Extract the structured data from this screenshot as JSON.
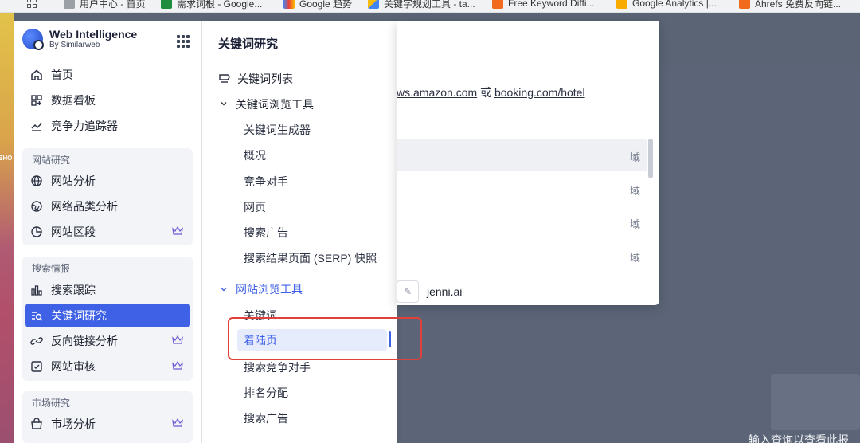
{
  "bookmarks": [
    {
      "label": "用户中心 - 首页",
      "color": "#6b7280"
    },
    {
      "label": "需求词根 - Google...",
      "color": "#1e8e3e"
    },
    {
      "label": "Google 趋势",
      "color": "#4285f4"
    },
    {
      "label": "关键字规划工具 - ta...",
      "color": "#fbbc04"
    },
    {
      "label": "Free Keyword Diffi...",
      "color": "#f26b1d"
    },
    {
      "label": "Google Analytics |...",
      "color": "#f9ab00"
    },
    {
      "label": "Ahrefs 免费反向链...",
      "color": "#f26b1d"
    }
  ],
  "sidebar": {
    "brand_title": "Web Intelligence",
    "brand_sub": "By Similarweb",
    "top_items": [
      {
        "label": "首页",
        "icon": "home-icon"
      },
      {
        "label": "数据看板",
        "icon": "dashboard-icon"
      },
      {
        "label": "竞争力追踪器",
        "icon": "trend-icon"
      }
    ],
    "groups": [
      {
        "label": "网站研究",
        "items": [
          {
            "label": "网站分析",
            "icon": "globe-icon",
            "crown": false
          },
          {
            "label": "网络品类分析",
            "icon": "globe-category-icon",
            "crown": false
          },
          {
            "label": "网站区段",
            "icon": "pie-icon",
            "crown": true
          }
        ]
      },
      {
        "label": "搜索情报",
        "items": [
          {
            "label": "搜索跟踪",
            "icon": "bar-chart-icon",
            "crown": false
          },
          {
            "label": "关键词研究",
            "icon": "keyword-search-icon",
            "crown": false,
            "active": true
          },
          {
            "label": "反向链接分析",
            "icon": "link-icon",
            "crown": true
          },
          {
            "label": "网站审核",
            "icon": "audit-icon",
            "crown": true
          }
        ]
      },
      {
        "label": "市场研究",
        "items": [
          {
            "label": "市场分析",
            "icon": "market-icon",
            "crown": true
          }
        ]
      }
    ]
  },
  "flyout": {
    "title": "关键词研究",
    "list_label": "关键词列表",
    "kw_browser": {
      "label": "关键词浏览工具",
      "items": [
        "关键词生成器",
        "概况",
        "竞争对手",
        "网页",
        "搜索广告",
        "搜索结果页面 (SERP) 快照"
      ]
    },
    "site_browser": {
      "label": "网站浏览工具",
      "items": [
        "关键词",
        "着陆页",
        "搜索竞争对手",
        "排名分配",
        "搜索广告"
      ],
      "selected": "着陆页"
    }
  },
  "card": {
    "hint_link1": "ws.amazon.com",
    "hint_or": " 或 ",
    "hint_link2": "booking.com/hotel",
    "domain_label": "域",
    "recent": "jenni.ai"
  },
  "background": {
    "shop_text": "SHO",
    "bottom_text": "输入查询以查看此报"
  }
}
